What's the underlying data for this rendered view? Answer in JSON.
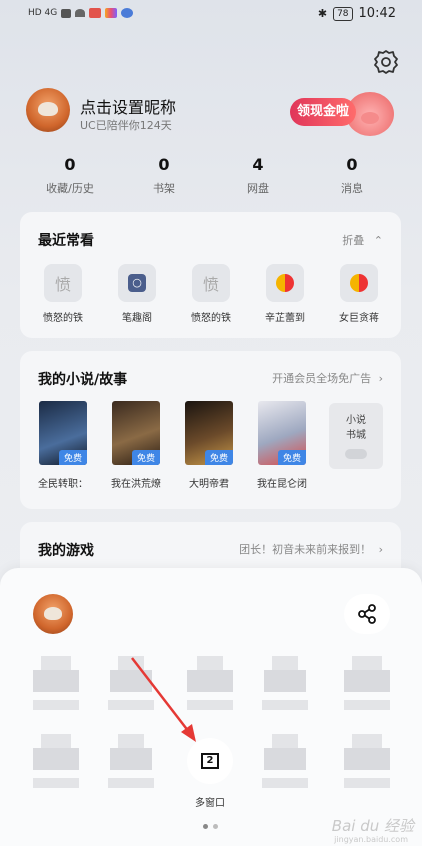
{
  "status_bar": {
    "left": "HD 4G",
    "time": "10:42",
    "battery": "78"
  },
  "profile": {
    "nickname": "点击设置昵称",
    "subtitle": "UC已陪伴你124天",
    "banner_label": "领现金啦"
  },
  "stats": [
    {
      "value": "0",
      "label": "收藏/历史"
    },
    {
      "value": "0",
      "label": "书架"
    },
    {
      "value": "4",
      "label": "网盘"
    },
    {
      "value": "0",
      "label": "消息"
    }
  ],
  "recent": {
    "title": "最近常看",
    "collapse_label": "折叠",
    "items": [
      {
        "label": "愤怒的铁",
        "icon": "愤"
      },
      {
        "label": "笔趣阁",
        "icon": "search"
      },
      {
        "label": "愤怒的铁",
        "icon": "愤"
      },
      {
        "label": "辛芷蕾到",
        "icon": "toutiao"
      },
      {
        "label": "女巨贪蒋",
        "icon": "toutiao"
      }
    ]
  },
  "novels": {
    "title": "我的小说/故事",
    "link": "开通会员全场免广告",
    "books": [
      {
        "label": "全民转职：",
        "tag": "免费"
      },
      {
        "label": "我在洪荒燎",
        "tag": "免费"
      },
      {
        "label": "大明帝君",
        "tag": "免费"
      },
      {
        "label": "我在昆仑闭",
        "tag": "免费"
      }
    ],
    "shelf_label": "小说\n书城"
  },
  "games": {
    "title": "我的游戏",
    "link": "团长！初音未来前来报到！"
  },
  "sheet": {
    "multiwindow_count": "2",
    "multiwindow_label": "多窗口"
  },
  "watermark": {
    "text": "Bai du 经验",
    "sub": "jingyan.baidu.com"
  },
  "colors": {
    "accent_blue": "#3f86e6",
    "banner_red": "#e0365a",
    "arrow_red": "#e53935"
  }
}
